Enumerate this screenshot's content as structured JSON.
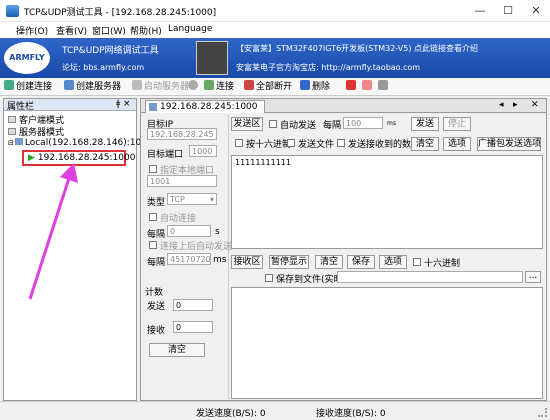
{
  "window": {
    "title": "TCP&UDP测试工具 - [192.168.28.245:1000]"
  },
  "menu": [
    "操作(O)",
    "查看(V)",
    "窗口(W)",
    "帮助(H)",
    "Language"
  ],
  "banner": {
    "logo": "ARMFLY",
    "left_title": "TCP&UDP网络调试工具",
    "left_sub": "论坛: bbs.armfly.com",
    "right_title": "【安富莱】STM32F407IGT6开发板(STM32-V5) 点此链接查看介绍",
    "right_sub": "安富莱电子官方淘宝店: http://armfly.taobao.com"
  },
  "toolbar": [
    "创建连接",
    "创建服务器",
    "启动服务器",
    "连接",
    "全部断开",
    "删除"
  ],
  "left_panel": {
    "title": "属性栏",
    "pin": "ǂ ×",
    "items": [
      "客户端模式",
      "服务器模式",
      "Local(192.168.28.146):1001",
      "192.168.28.245:1000"
    ]
  },
  "tab": {
    "label": "192.168.28.245:1000"
  },
  "config": {
    "target_ip_label": "目标IP",
    "target_ip": "192.168.28.245",
    "target_port_label": "目标端口",
    "target_port": "1000",
    "local_port_label": "指定本地端口",
    "local_port": "1001",
    "type_label": "类型",
    "type": "TCP",
    "auto_connect": "自动连接",
    "interval_label": "每隔",
    "interval_val": "0",
    "interval_unit": "s",
    "auto_send_after": "连接上后自动发送",
    "interval2_label": "每隔",
    "interval2_val": "45170720",
    "ms": "ms"
  },
  "count": {
    "title": "计数",
    "send_label": "发送",
    "send_val": "0",
    "recv_label": "接收",
    "recv_val": "0",
    "clear": "清空"
  },
  "send": {
    "area_label": "发送区",
    "auto_send": "自动发送",
    "interval_label": "每隔",
    "interval_val": "100",
    "ms": "ms",
    "send_btn": "发送",
    "stop_btn": "停止",
    "hex": "按十六进制",
    "send_file": "发送文件",
    "send_recv": "发送接收到的数据",
    "clear": "清空",
    "options": "选项",
    "broadcast": "广播包发送选项",
    "content": "11111111111"
  },
  "recv": {
    "area_label": "接收区",
    "pause": "暂停显示",
    "clear": "清空",
    "save": "保存",
    "options": "选项",
    "hex": "十六进制",
    "save_file": "保存到文件(实时)",
    "browse": "..."
  },
  "status": {
    "send_speed": "发送速度(B/S): 0",
    "recv_speed": "接收速度(B/S): 0"
  },
  "colors": {
    "banner": "#1a49a8",
    "highlight": "#e0303a",
    "arrow": "#e040e0"
  }
}
